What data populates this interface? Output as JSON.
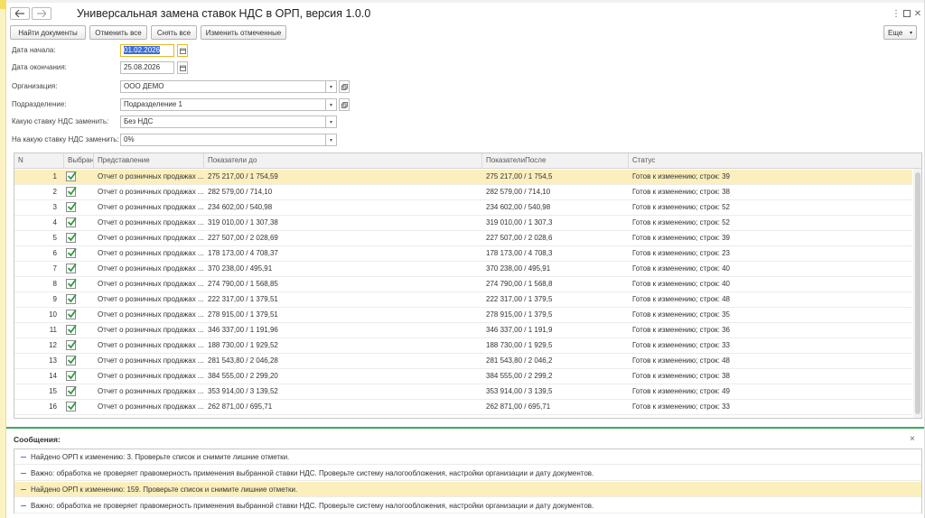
{
  "window": {
    "title": "Универсальная замена ставок НДС в ОРП, версия 1.0.0"
  },
  "toolbar": {
    "find": "Найти документы",
    "uncheck_all": "Отменить все",
    "clear_all": "Снять все",
    "change_marked": "Изменить отмеченные",
    "more": "Еще"
  },
  "form": {
    "start_date_label": "Дата начала:",
    "start_date": "01.02.2026",
    "end_date_label": "Дата окончания:",
    "end_date": "25.08.2026",
    "org_label": "Организация:",
    "org": "ООО ДЕМО",
    "division_label": "Подразделение:",
    "division": "Подразделение 1",
    "from_rate_label": "Какую ставку НДС заменить:",
    "from_rate": "Без НДС",
    "to_rate_label": "На какую ставку НДС заменить:",
    "to_rate": "0%"
  },
  "table": {
    "columns": [
      "N",
      "Выбран",
      "Представление",
      "Показатели до",
      "ПоказателиПосле",
      "Статус"
    ],
    "rows": [
      {
        "n": "1",
        "checked": true,
        "repr": "Отчет о розничных продажах ...",
        "before": "275 217,00 / 1 754,59",
        "after": "275 217,00 / 1 754,5",
        "status": "Готов к изменению; строк: 39"
      },
      {
        "n": "2",
        "checked": true,
        "repr": "Отчет о розничных продажах ...",
        "before": "282 579,00 / 714,10",
        "after": "282 579,00 / 714,10",
        "status": "Готов к изменению; строк: 38"
      },
      {
        "n": "3",
        "checked": true,
        "repr": "Отчет о розничных продажах ...",
        "before": "234 602,00 / 540,98",
        "after": "234 602,00 / 540,98",
        "status": "Готов к изменению; строк: 52"
      },
      {
        "n": "4",
        "checked": true,
        "repr": "Отчет о розничных продажах ...",
        "before": "319 010,00 / 1 307,38",
        "after": "319 010,00 / 1 307,3",
        "status": "Готов к изменению; строк: 52"
      },
      {
        "n": "5",
        "checked": true,
        "repr": "Отчет о розничных продажах ...",
        "before": "227 507,00 / 2 028,69",
        "after": "227 507,00 / 2 028,6",
        "status": "Готов к изменению; строк: 39"
      },
      {
        "n": "6",
        "checked": true,
        "repr": "Отчет о розничных продажах ...",
        "before": "178 173,00 / 4 708,37",
        "after": "178 173,00 / 4 708,3",
        "status": "Готов к изменению; строк: 23"
      },
      {
        "n": "7",
        "checked": true,
        "repr": "Отчет о розничных продажах ...",
        "before": "370 238,00 / 495,91",
        "after": "370 238,00 / 495,91",
        "status": "Готов к изменению; строк: 40"
      },
      {
        "n": "8",
        "checked": true,
        "repr": "Отчет о розничных продажах ...",
        "before": "274 790,00 / 1 568,85",
        "after": "274 790,00 / 1 568,8",
        "status": "Готов к изменению; строк: 40"
      },
      {
        "n": "9",
        "checked": true,
        "repr": "Отчет о розничных продажах ...",
        "before": "222 317,00 / 1 379,51",
        "after": "222 317,00 / 1 379,5",
        "status": "Готов к изменению; строк: 48"
      },
      {
        "n": "10",
        "checked": true,
        "repr": "Отчет о розничных продажах ...",
        "before": "278 915,00 / 1 379,51",
        "after": "278 915,00 / 1 379,5",
        "status": "Готов к изменению; строк: 35"
      },
      {
        "n": "11",
        "checked": true,
        "repr": "Отчет о розничных продажах ...",
        "before": "346 337,00 / 1 191,96",
        "after": "346 337,00 / 1 191,9",
        "status": "Готов к изменению; строк: 36"
      },
      {
        "n": "12",
        "checked": true,
        "repr": "Отчет о розничных продажах ...",
        "before": "188 730,00 / 1 929,52",
        "after": "188 730,00 / 1 929,5",
        "status": "Готов к изменению; строк: 33"
      },
      {
        "n": "13",
        "checked": true,
        "repr": "Отчет о розничных продажах ...",
        "before": "281 543,80 / 2 046,28",
        "after": "281 543,80 / 2 046,2",
        "status": "Готов к изменению; строк: 48"
      },
      {
        "n": "14",
        "checked": true,
        "repr": "Отчет о розничных продажах ...",
        "before": "384 555,00 / 2 299,20",
        "after": "384 555,00 / 2 299,2",
        "status": "Готов к изменению; строк: 38"
      },
      {
        "n": "15",
        "checked": true,
        "repr": "Отчет о розничных продажах ...",
        "before": "353 914,00 / 3 139,52",
        "after": "353 914,00 / 3 139,5",
        "status": "Готов к изменению; строк: 49"
      },
      {
        "n": "16",
        "checked": true,
        "repr": "Отчет о розничных продажах ...",
        "before": "262 871,00 / 695,71",
        "after": "262 871,00 / 695,71",
        "status": "Готов к изменению; строк: 33"
      }
    ]
  },
  "messages": {
    "title": "Сообщения:",
    "items": [
      "Найдено ОРП к изменению: 3. Проверьте список и снимите лишние отметки.",
      "Важно: обработка не проверяет правомерность применения выбранной ставки НДС. Проверьте систему налогообложения, настройки организации и дату документов.",
      "Найдено ОРП к изменению: 159. Проверьте список и снимите лишние отметки.",
      "Важно: обработка не проверяет правомерность применения выбранной ставки НДС. Проверьте систему налогообложения, настройки организации и дату документов."
    ]
  },
  "colors": {
    "accent_green": "#3fa85a",
    "active_row": "#fbefbd",
    "focus_border": "#e8b923",
    "checkbox_green": "#2e9a3e"
  },
  "icons": [
    "back-arrow-icon",
    "forward-arrow-icon",
    "more-vert-icon",
    "restore-window-icon",
    "close-icon",
    "calendar-icon",
    "chevron-down-icon",
    "open-link-icon",
    "checkmark-icon"
  ]
}
